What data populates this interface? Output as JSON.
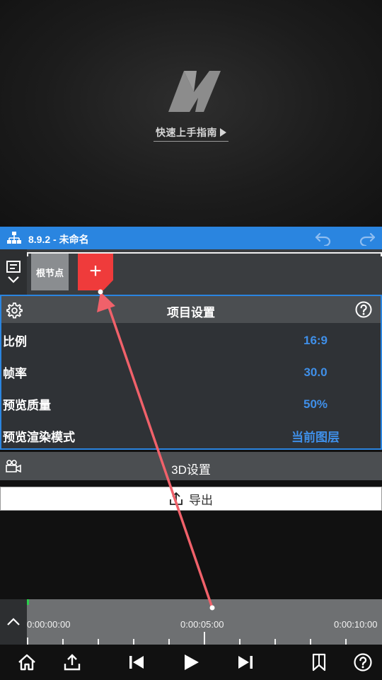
{
  "preview": {
    "guide_label": "快速上手指南"
  },
  "header": {
    "title": "8.9.2 - 未命名"
  },
  "nodes": {
    "root_label": "根节点",
    "add_label": "+"
  },
  "project_settings": {
    "title": "项目设置",
    "rows": [
      {
        "label": "比例",
        "value": "16:9"
      },
      {
        "label": "帧率",
        "value": "30.0"
      },
      {
        "label": "预览质量",
        "value": "50%"
      },
      {
        "label": "预览渲染模式",
        "value": "当前图层"
      }
    ]
  },
  "three_d": {
    "label": "3D设置"
  },
  "export": {
    "label": "导出"
  },
  "timeline": {
    "times": [
      "0:00:00:00",
      "0:00:05:00",
      "0:00:10:00"
    ]
  },
  "colors": {
    "accent": "#2a85e0",
    "value_text": "#3f8fe8",
    "add_node": "#ef3b3b",
    "playhead": "#29d04a"
  }
}
